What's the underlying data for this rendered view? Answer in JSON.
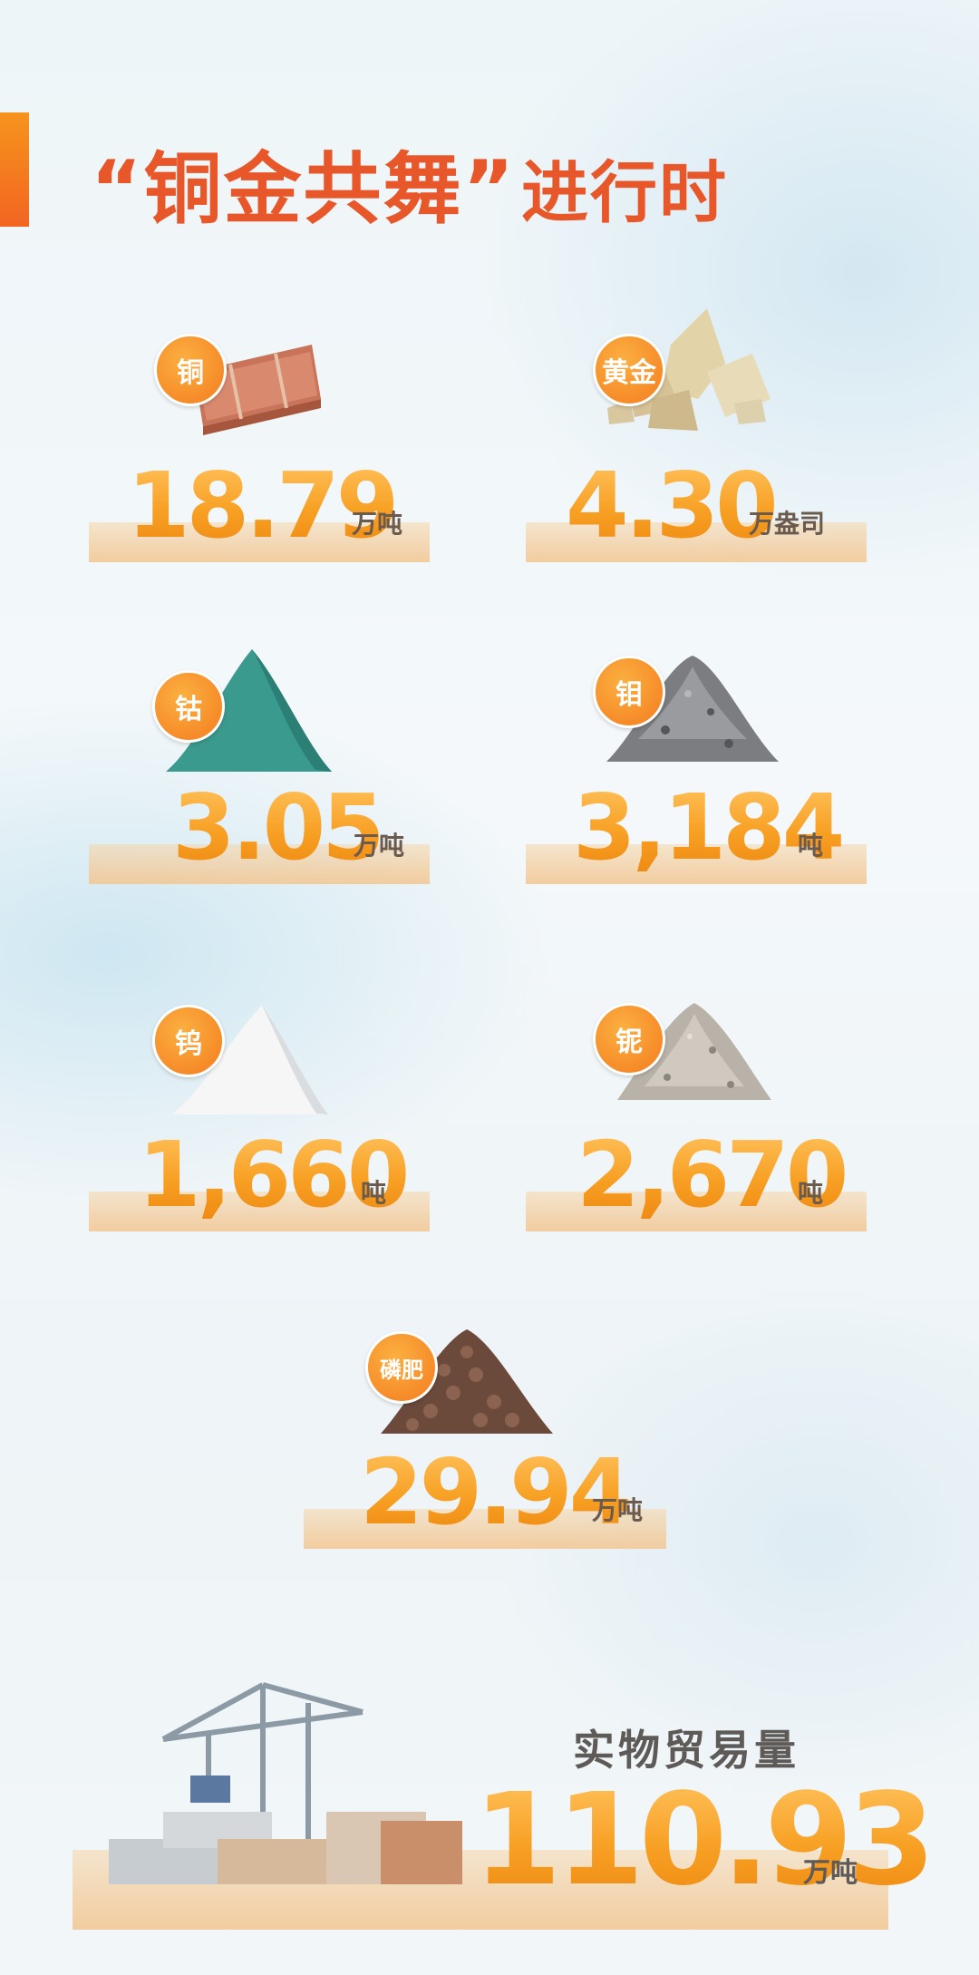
{
  "header": {
    "title_main": "“铜金共舞”",
    "title_sub": "进行时"
  },
  "stats": [
    {
      "badge": "铜",
      "value": "18.79",
      "unit": "万吨",
      "icon": "copper-cathode-stack-icon"
    },
    {
      "badge": "黄金",
      "value": "4.30",
      "unit": "万盎司",
      "icon": "gold-ore-rocks-icon"
    },
    {
      "badge": "钴",
      "value": "3.05",
      "unit": "万吨",
      "icon": "cobalt-powder-pile-icon"
    },
    {
      "badge": "钼",
      "value": "3,184",
      "unit": "吨",
      "icon": "molybdenum-gravel-pile-icon"
    },
    {
      "badge": "钨",
      "value": "1,660",
      "unit": "吨",
      "icon": "tungsten-white-powder-icon"
    },
    {
      "badge": "铌",
      "value": "2,670",
      "unit": "吨",
      "icon": "niobium-gravel-pile-icon"
    },
    {
      "badge": "磷肥",
      "value": "29.94",
      "unit": "万吨",
      "icon": "phosphate-fertilizer-pellets-icon"
    }
  ],
  "trade": {
    "label": "实物贸易量",
    "value": "110.93",
    "unit": "万吨",
    "icon": "port-crane-containers-icon"
  },
  "colors": {
    "accent": "#f26522",
    "title": "#e8572a",
    "number": "#f7a024",
    "unit_text": "#6b5a4e"
  }
}
